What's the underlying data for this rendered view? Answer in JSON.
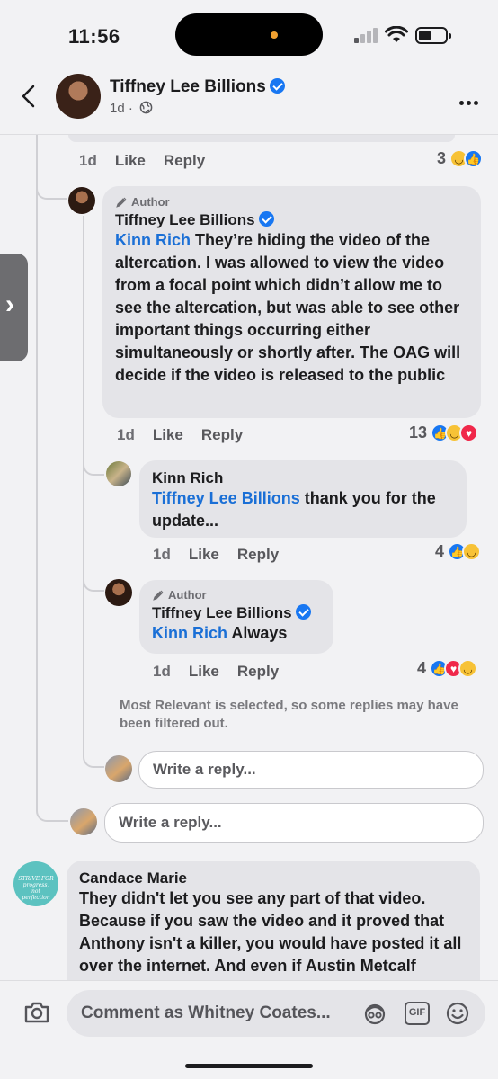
{
  "status_bar": {
    "time": "11:56"
  },
  "header": {
    "name": "Tiffney Lee Billions",
    "meta": "1d ·"
  },
  "prev_comment": {
    "time": "1d",
    "like": "Like",
    "reply": "Reply",
    "reaction_count": "3"
  },
  "comment1": {
    "author_tag": "Author",
    "name": "Tiffney Lee Billions",
    "mention": "Kinn Rich",
    "text": " They’re hiding the video of the altercation. I was allowed to view the video from a focal point which didn’t allow me to see the altercation, but was able to see other important things occurring either simultaneously or shortly after. The OAG will decide if the video is released to the public",
    "time": "1d",
    "like": "Like",
    "reply": "Reply",
    "reaction_count": "13"
  },
  "reply1": {
    "name": "Kinn Rich",
    "mention": "Tiffney Lee Billions",
    "text": " thank you for the update...",
    "time": "1d",
    "like": "Like",
    "reply": "Reply",
    "reaction_count": "4"
  },
  "reply2": {
    "author_tag": "Author",
    "name": "Tiffney Lee Billions",
    "mention": "Kinn Rich",
    "text": " Always",
    "time": "1d",
    "like": "Like",
    "reply": "Reply",
    "reaction_count": "4"
  },
  "filter_note": "Most Relevant is selected, so some replies may have been filtered out.",
  "write_reply_inner": "Write a reply...",
  "write_reply_outer": "Write a reply...",
  "comment2": {
    "name": "Candace Marie",
    "avatar_text": "STRIVE FOR progress, not perfection",
    "text": "They didn't let you see any part of that video. Because if you saw the video and it proved that Anthony isn't a killer, you would have posted it all over the internet. And even if Austin Metcalf"
  },
  "bottom": {
    "placeholder": "Comment as Whitney Coates...",
    "gif_label": "GIF"
  },
  "colors": {
    "accent": "#1877f2",
    "mention": "#1a6fd6",
    "bubble": "#e4e4e8",
    "background": "#f2f2f4"
  },
  "icons": [
    "back-chevron-icon",
    "globe-icon",
    "more-icon",
    "verified-icon",
    "author-pen-icon",
    "like-reaction-icon",
    "haha-reaction-icon",
    "love-reaction-icon",
    "camera-icon",
    "avatar-sticker-icon",
    "gif-icon",
    "emoji-icon"
  ]
}
